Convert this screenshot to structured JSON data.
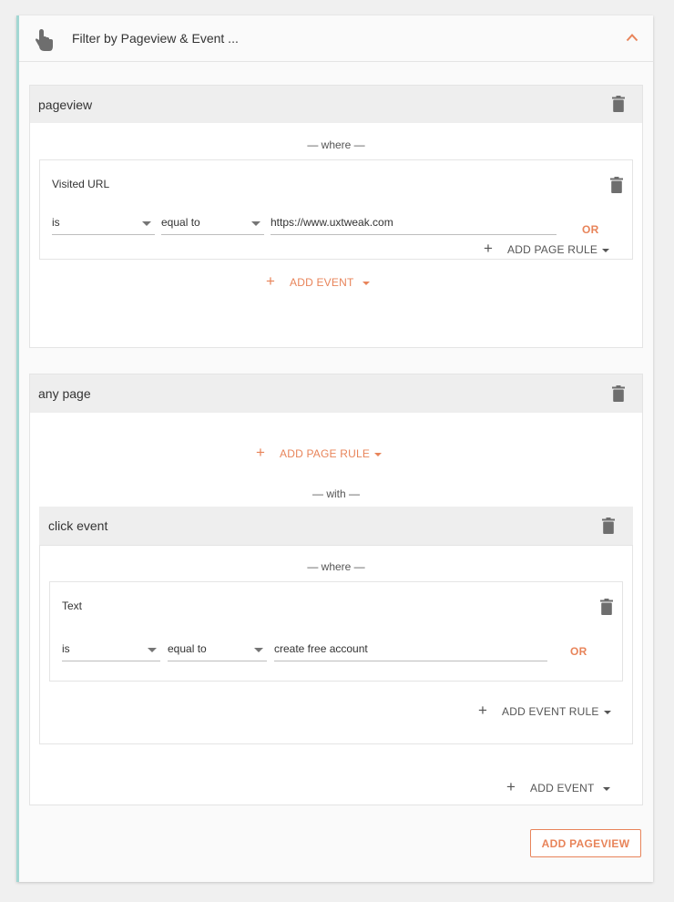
{
  "header": {
    "title": "Filter by Pageview & Event ...",
    "icon": "touch-hand-icon",
    "collapse_icon": "chevron-up-icon"
  },
  "colors": {
    "accent": "#e8845a",
    "left_border": "#a3d7d3",
    "bar_bg": "#eeeeee"
  },
  "pageview1": {
    "title": "pageview",
    "where": "— where —",
    "rule": {
      "label": "Visited URL",
      "operator": "is",
      "comparison": "equal to",
      "value": "https://www.uxtweak.com",
      "or": "OR"
    },
    "add_page_rule": "ADD PAGE RULE",
    "add_event": "ADD EVENT"
  },
  "pageview2": {
    "title": "any page",
    "add_page_rule": "ADD PAGE RULE",
    "with": "— with —",
    "event": {
      "title": "click event",
      "where": "— where —",
      "rule": {
        "label": "Text",
        "operator": "is",
        "comparison": "equal to",
        "value": "create free account",
        "or": "OR"
      },
      "add_event_rule": "ADD EVENT RULE"
    },
    "add_event": "ADD EVENT"
  },
  "add_pageview": "ADD PAGEVIEW"
}
